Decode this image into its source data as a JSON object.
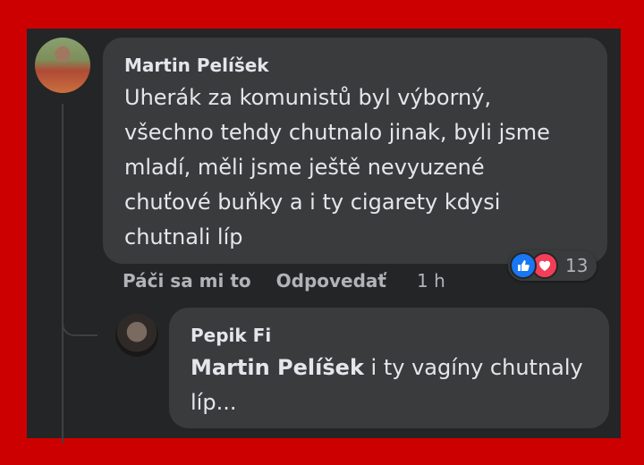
{
  "comment": {
    "author": "Martin Pelíšek",
    "lines": [
      "Uherák za komunistů byl výborný,",
      "všechno tehdy chutnalo jinak, byli jsme",
      "mladí, měli jsme ještě nevyuzené",
      "chuťové buňky a i ty cigarety kdysi",
      "chutnali líp"
    ],
    "reactions": {
      "count": "13",
      "icons": [
        "like-icon",
        "love-icon"
      ]
    },
    "actions": {
      "like": "Páči sa mi to",
      "reply": "Odpovedať",
      "time": "1 h"
    }
  },
  "reply": {
    "author": "Pepik Fi",
    "mention": "Martin Pelíšek",
    "lines": [
      " i ty vagíny chutnaly",
      "líp..."
    ]
  },
  "colors": {
    "frame": "#cc0000",
    "panel": "#242526",
    "bubble": "#3a3b3c",
    "like": "#1877f2",
    "love": "#f33e58"
  }
}
